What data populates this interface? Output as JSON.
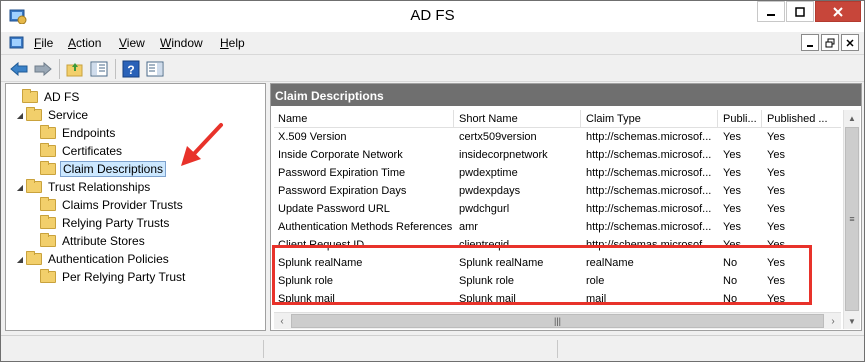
{
  "window": {
    "title": "AD FS",
    "accent_close": "#c7463a",
    "highlight_color": "#e8322a"
  },
  "menu": {
    "items": [
      {
        "label": "File",
        "hotkey": "F",
        "rest": "ile"
      },
      {
        "label": "Action",
        "hotkey": "A",
        "rest": "ction"
      },
      {
        "label": "View",
        "hotkey": "V",
        "rest": "iew"
      },
      {
        "label": "Window",
        "hotkey": "W",
        "rest": "indow"
      },
      {
        "label": "Help",
        "hotkey": "H",
        "rest": "elp"
      }
    ]
  },
  "toolbar": {
    "buttons": [
      "back-arrow-icon",
      "forward-arrow-icon",
      "up-folder-icon",
      "show-hide-tree-icon",
      "help-icon",
      "action-pane-icon"
    ]
  },
  "tree": {
    "items": [
      {
        "label": "AD FS",
        "level": 0,
        "expanded": null
      },
      {
        "label": "Service",
        "level": 1,
        "expanded": true
      },
      {
        "label": "Endpoints",
        "level": 2,
        "expanded": null
      },
      {
        "label": "Certificates",
        "level": 2,
        "expanded": null
      },
      {
        "label": "Claim Descriptions",
        "level": 2,
        "expanded": null,
        "selected": true
      },
      {
        "label": "Trust Relationships",
        "level": 1,
        "expanded": true
      },
      {
        "label": "Claims Provider Trusts",
        "level": 2,
        "expanded": null
      },
      {
        "label": "Relying Party Trusts",
        "level": 2,
        "expanded": null
      },
      {
        "label": "Attribute Stores",
        "level": 2,
        "expanded": null
      },
      {
        "label": "Authentication Policies",
        "level": 1,
        "expanded": true
      },
      {
        "label": "Per Relying Party Trust",
        "level": 2,
        "expanded": null
      }
    ]
  },
  "main": {
    "header": "Claim Descriptions",
    "columns": [
      "Name",
      "Short Name",
      "Claim Type",
      "Publi...",
      "Published ..."
    ],
    "rows": [
      [
        "X.509 Version",
        "certx509version",
        "http://schemas.microsof...",
        "Yes",
        "Yes"
      ],
      [
        "Inside Corporate Network",
        "insidecorpnetwork",
        "http://schemas.microsof...",
        "Yes",
        "Yes"
      ],
      [
        "Password Expiration Time",
        "pwdexptime",
        "http://schemas.microsof...",
        "Yes",
        "Yes"
      ],
      [
        "Password Expiration Days",
        "pwdexpdays",
        "http://schemas.microsof...",
        "Yes",
        "Yes"
      ],
      [
        "Update Password URL",
        "pwdchgurl",
        "http://schemas.microsof...",
        "Yes",
        "Yes"
      ],
      [
        "Authentication Methods References",
        "amr",
        "http://schemas.microsof...",
        "Yes",
        "Yes"
      ],
      [
        "Client Request ID",
        "clientreqid",
        "http://schemas.microsof...",
        "Yes",
        "Yes"
      ],
      [
        "Splunk realName",
        "Splunk realName",
        "realName",
        "No",
        "Yes"
      ],
      [
        "Splunk role",
        "Splunk role",
        "role",
        "No",
        "Yes"
      ],
      [
        "Splunk mail",
        "Splunk mail",
        "mail",
        "No",
        "Yes"
      ]
    ]
  }
}
